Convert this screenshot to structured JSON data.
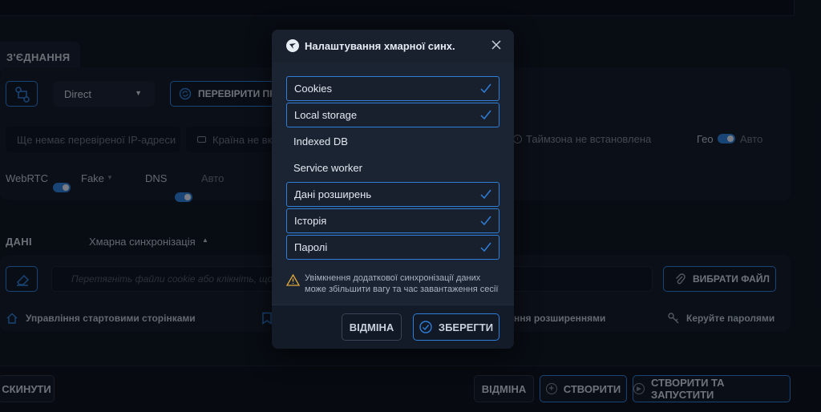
{
  "connection": {
    "section_title": "З'ЄДНАННЯ",
    "proxy_type": "Direct",
    "check_button": "ПЕРЕВІРИТИ ПРО",
    "ip_placeholder": "Ще немає перевіреної IP-адреси",
    "country": "Країна не вк",
    "timezone": "Таймзона не встановлена",
    "geo_label": "Гео",
    "geo_mode": "Авто",
    "webrtc_label": "WebRTC",
    "webrtc_mode": "Fake",
    "dns_label": "DNS",
    "dns_mode": "Авто"
  },
  "data_section": {
    "section_title": "ДАНІ",
    "cloud_sync_label": "Хмарна синхронізація",
    "file_drop_placeholder": "Перетягніть файли cookie або клікніть, щоб ві",
    "choose_file_button": "ВИБРАТИ ФАЙЛ",
    "links": {
      "start_pages": "Управління стартовими сторінками",
      "extensions": "ння розширеннями",
      "passwords": "Керуйте паролями"
    }
  },
  "footer": {
    "reset_button": "СКИНУТИ",
    "cancel_button": "ВІДМІНА",
    "create_button": "СТВОРИТИ",
    "create_start_button": "СТВОРИТИ ТА ЗАПУСТИТИ"
  },
  "modal": {
    "title": "Налаштування хмарної синх.",
    "items": [
      {
        "label": "Cookies",
        "checked": true
      },
      {
        "label": "Local storage",
        "checked": true
      },
      {
        "label": "Indexed DB",
        "checked": false
      },
      {
        "label": "Service worker",
        "checked": false
      },
      {
        "label": "Дані розширень",
        "checked": true
      },
      {
        "label": "Історія",
        "checked": true
      },
      {
        "label": "Паролі",
        "checked": true
      }
    ],
    "warning_line1": "Увімкнення додаткової синхронізації даних",
    "warning_line2": "може збільшити вагу та час завантаження сесії",
    "cancel_button": "ВІДМІНА",
    "save_button": "ЗБЕРЕГТИ"
  },
  "colors": {
    "accent": "#2f7ed8",
    "background": "#0f1624",
    "warning": "#e0a83a"
  },
  "icons": [
    "route-icon",
    "refresh-icon",
    "flag-icon",
    "clock-icon",
    "eraser-icon",
    "paperclip-icon",
    "home-icon",
    "bookmark-icon",
    "key-icon",
    "plus-circle-icon",
    "play-circle-icon",
    "cloud-logo-icon",
    "close-icon",
    "check-icon",
    "warning-icon",
    "check-circle-icon"
  ]
}
